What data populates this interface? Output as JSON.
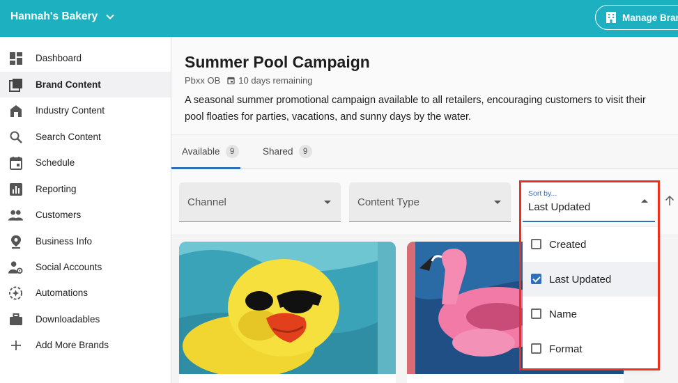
{
  "topbar": {
    "brand_name": "Hannah's Bakery",
    "manage_label": "Manage Brands",
    "color": "#1cb0c0"
  },
  "sidebar": {
    "items": [
      {
        "label": "Dashboard",
        "icon": "dashboard-icon"
      },
      {
        "label": "Brand Content",
        "icon": "library-icon",
        "active": true
      },
      {
        "label": "Industry Content",
        "icon": "store-icon"
      },
      {
        "label": "Search Content",
        "icon": "search-icon"
      },
      {
        "label": "Schedule",
        "icon": "calendar-icon"
      },
      {
        "label": "Reporting",
        "icon": "chart-icon"
      },
      {
        "label": "Customers",
        "icon": "people-icon"
      },
      {
        "label": "Business Info",
        "icon": "location-pin-icon"
      },
      {
        "label": "Social Accounts",
        "icon": "person-gear-icon"
      },
      {
        "label": "Automations",
        "icon": "automation-icon"
      },
      {
        "label": "Downloadables",
        "icon": "briefcase-icon"
      },
      {
        "label": "Add More Brands",
        "icon": "plus-icon"
      }
    ]
  },
  "campaign": {
    "title": "Summer Pool Campaign",
    "owner": "Pbxx OB",
    "remaining": "10 days remaining",
    "description_line1": "A seasonal summer promotional campaign available to all retailers, encouraging customers to visit their",
    "description_line2": "pool floaties for parties, vacations, and sunny days by the water."
  },
  "tabs": [
    {
      "label": "Available",
      "count": "9",
      "active": true
    },
    {
      "label": "Shared",
      "count": "9"
    }
  ],
  "filters": {
    "channel_label": "Channel",
    "content_type_label": "Content Type",
    "sort_label": "Sort by...",
    "sort_value": "Last Updated"
  },
  "sort_menu": {
    "options": [
      {
        "label": "Created",
        "checked": false
      },
      {
        "label": "Last Updated",
        "checked": true
      },
      {
        "label": "Name",
        "checked": false
      },
      {
        "label": "Format",
        "checked": false
      }
    ]
  },
  "accent_color": "#2f6fba",
  "highlight_color": "#e8321f"
}
